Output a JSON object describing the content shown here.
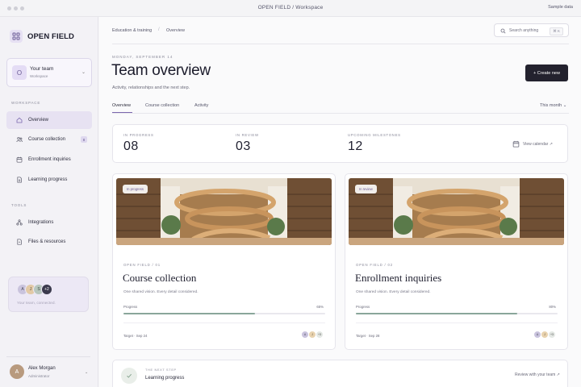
{
  "window": {
    "title": "OPEN FIELD / Workspace",
    "sample_label": "Sample data"
  },
  "sidebar": {
    "brand": "OPEN FIELD",
    "team": {
      "initial": "O",
      "name": "Your team",
      "sub": "Workspace"
    },
    "workspace_label": "WORKSPACE",
    "workspace_items": [
      {
        "label": "Overview",
        "icon": "home-icon",
        "active": true
      },
      {
        "label": "Course collection",
        "icon": "users-icon",
        "badge": "8"
      },
      {
        "label": "Enrollment inquiries",
        "icon": "calendar-icon"
      },
      {
        "label": "Learning progress",
        "icon": "document-icon"
      }
    ],
    "tools_label": "TOOLS",
    "tools_items": [
      {
        "label": "Integrations",
        "icon": "integrations-icon"
      },
      {
        "label": "Files & resources",
        "icon": "file-icon"
      }
    ],
    "collab": {
      "avatars": [
        "A",
        "J",
        "S"
      ],
      "more": "+2",
      "text": "Your team, connected."
    },
    "user": {
      "initial": "A",
      "name": "Alex Morgan",
      "role": "Administrator"
    }
  },
  "header": {
    "breadcrumb": [
      "Education & training",
      "Overview"
    ],
    "search_placeholder": "Search anything",
    "search_shortcut": "⌘ K"
  },
  "page": {
    "date": "MONDAY, SEPTEMBER 14",
    "title": "Team overview",
    "subtitle": "Activity, relationships and the next step.",
    "create_label": "+ Create new",
    "tabs": [
      "Overview",
      "Course collection",
      "Activity"
    ],
    "range": "This month ⌄"
  },
  "stats": [
    {
      "label": "IN PROGRESS",
      "value": "08"
    },
    {
      "label": "IN REVIEW",
      "value": "03"
    },
    {
      "label": "UPCOMING MILESTONES",
      "value": "12"
    }
  ],
  "view_calendar": "View calendar ↗",
  "projects": [
    {
      "badge": "In progress",
      "kicker": "OPEN FIELD / 01",
      "name": "Course collection",
      "desc": "One shared vision. Every detail considered.",
      "progress_label": "Progress",
      "progress_text": "65%",
      "progress": 0.65,
      "target": "Target · Sep 24",
      "avatars": [
        "A",
        "J"
      ],
      "more": "+3"
    },
    {
      "badge": "In review",
      "kicker": "OPEN FIELD / 02",
      "name": "Enrollment inquiries",
      "desc": "One shared vision. Every detail considered.",
      "progress_label": "Progress",
      "progress_text": "80%",
      "progress": 0.8,
      "target": "Target · Sep 28",
      "avatars": [
        "A",
        "J"
      ],
      "more": "+3"
    }
  ],
  "next_step": {
    "kicker": "THE NEXT STEP",
    "title": "Learning progress",
    "link": "Review with your team ↗"
  },
  "colors": {
    "accent": "#7b68ae",
    "dark_button": "#23222e",
    "progress": "#8aa69a"
  }
}
